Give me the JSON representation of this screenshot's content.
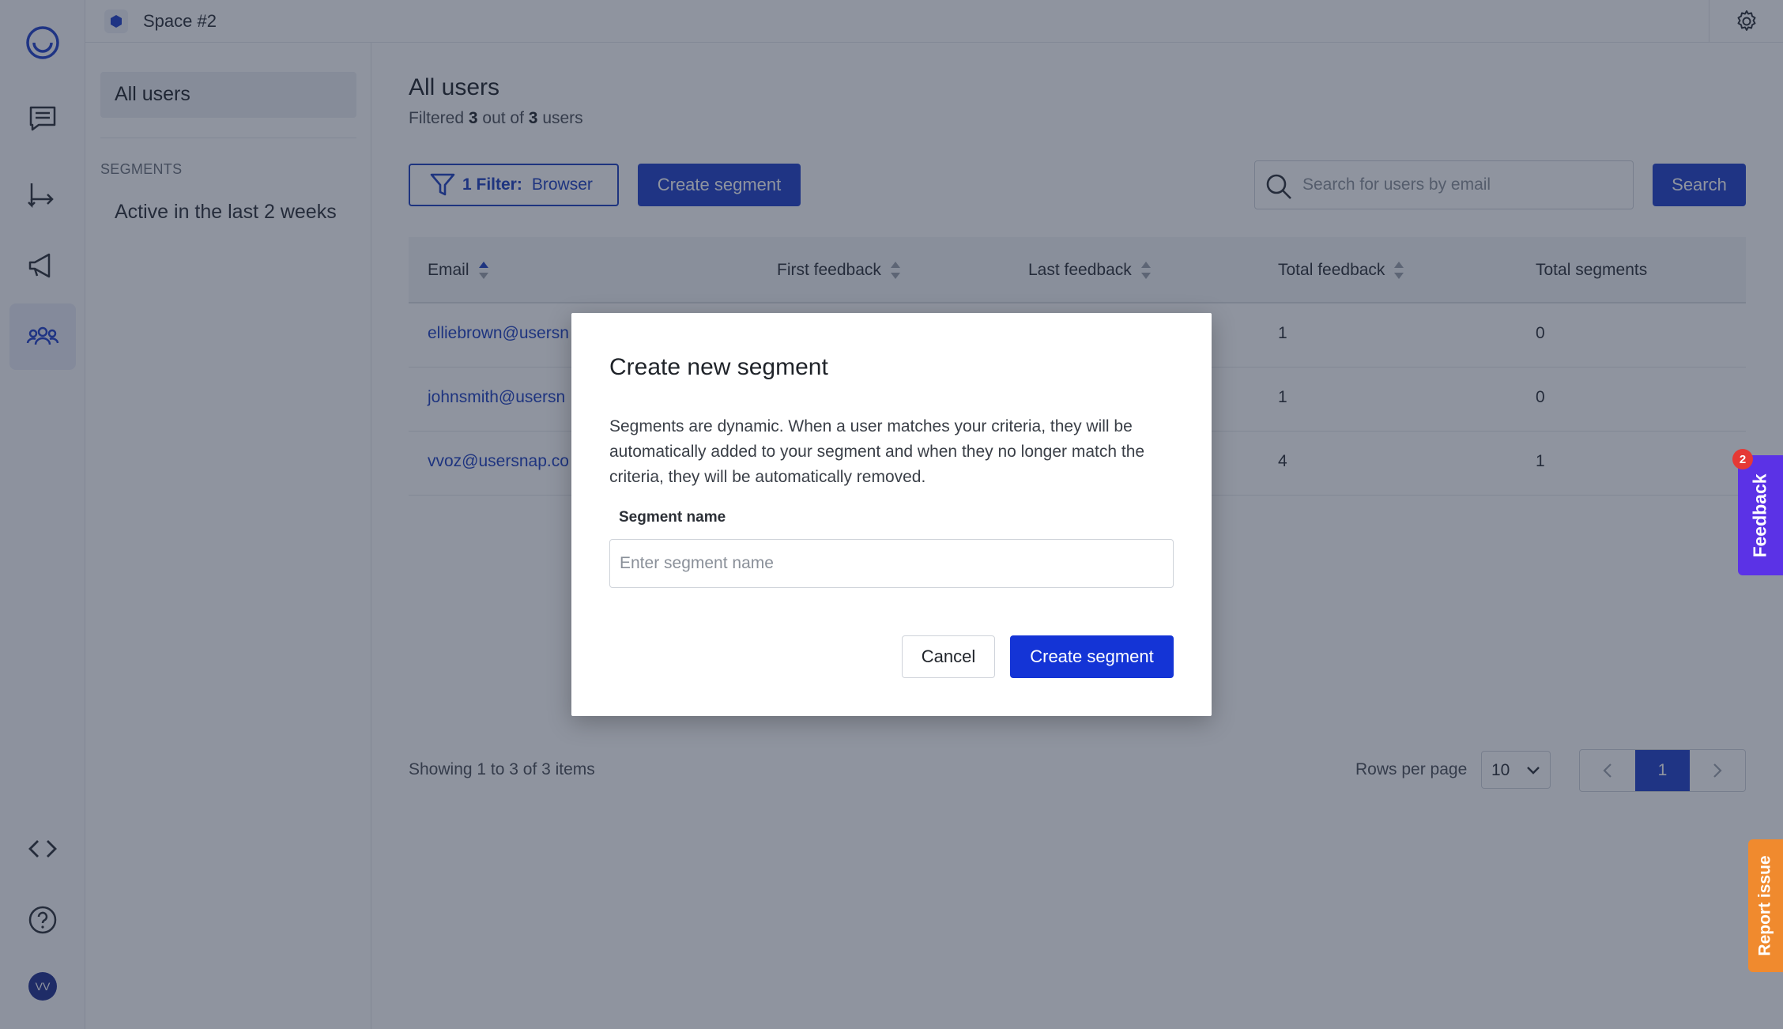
{
  "topbar": {
    "space_name": "Space #2"
  },
  "subnav": {
    "all_users": "All users",
    "segments_heading": "SEGMENTS",
    "segment_item": "Active in the last 2 weeks"
  },
  "main": {
    "title": "All users",
    "filtered_prefix": "Filtered",
    "filtered_count": "3",
    "filtered_middle": "out of",
    "filtered_total": "3",
    "filtered_suffix": "users",
    "filter_button_label": "1 Filter:",
    "filter_button_value": "Browser",
    "create_segment_label": "Create segment",
    "search_placeholder": "Search for users by email",
    "search_button": "Search"
  },
  "table": {
    "headers": [
      "Email",
      "First feedback",
      "Last feedback",
      "Total feedback",
      "Total segments"
    ],
    "rows": [
      {
        "email": "elliebrown@usersn",
        "total_feedback": "1",
        "total_segments": "0"
      },
      {
        "email": "johnsmith@usersn",
        "total_feedback": "1",
        "total_segments": "0"
      },
      {
        "email": "vvoz@usersnap.co",
        "total_feedback": "4",
        "total_segments": "1"
      }
    ]
  },
  "footer": {
    "showing": "Showing 1 to 3 of 3 items",
    "rows_per_page_label": "Rows per page",
    "rows_per_page_value": "10",
    "current_page": "1"
  },
  "modal": {
    "title": "Create new segment",
    "description": "Segments are dynamic. When a user matches your criteria, they will be automatically added to your segment and when they no longer match the criteria, they will be automatically removed.",
    "field_label": "Segment name",
    "field_placeholder": "Enter segment name",
    "cancel": "Cancel",
    "submit": "Create segment"
  },
  "widgets": {
    "feedback_label": "Feedback",
    "feedback_badge": "2",
    "report_label": "Report issue"
  },
  "user": {
    "initials": "VV"
  },
  "colors": {
    "primary": "#1f3fc8",
    "feedback": "#5b32e6",
    "report": "#f08a2e"
  }
}
